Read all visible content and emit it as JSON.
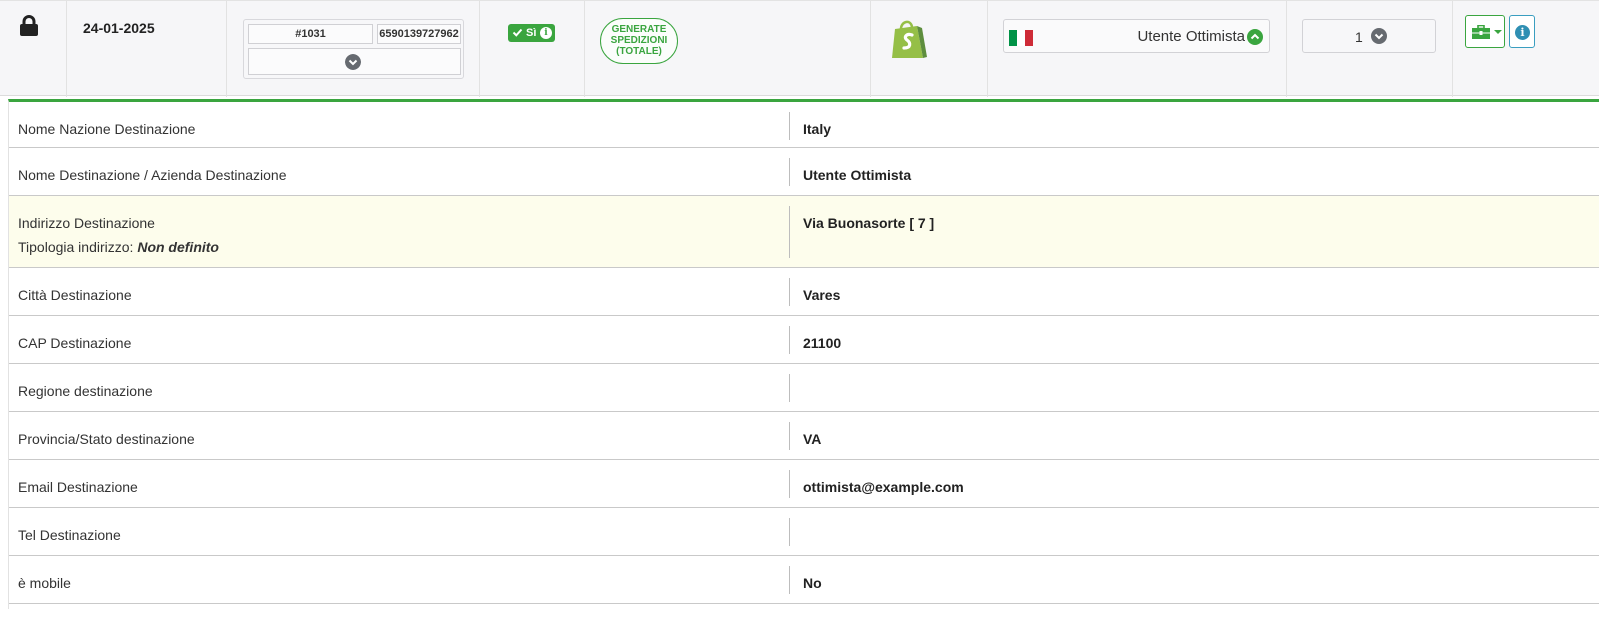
{
  "order": {
    "date": "24-01-2025",
    "order_number": "#1031",
    "external_id": "6590139727962",
    "status_badge": "Sì",
    "stamp_lines": [
      "GENERATE",
      "SPEDIZIONI",
      "(TOTALE)"
    ],
    "platform_icon": "shopify-icon",
    "customer_name": "Utente Ottimista",
    "country_flag_colors": [
      "#009246",
      "#ffffff",
      "#ce2b37"
    ],
    "quantity": "1"
  },
  "colors": {
    "accent_green": "#3aa53f",
    "info_blue": "#2f8fb3",
    "highlight_row": "#fdfdec"
  },
  "details": {
    "nazione": {
      "label": "Nome Nazione Destinazione",
      "value": "Italy"
    },
    "nome": {
      "label": "Nome Destinazione / Azienda Destinazione",
      "value": "Utente Ottimista"
    },
    "indirizzo": {
      "label": "Indirizzo Destinazione",
      "sub_label": "Tipologia indirizzo:",
      "sub_value": "Non definito",
      "value": "Via Buonasorte [ 7 ]"
    },
    "citta": {
      "label": "Città Destinazione",
      "value": "Vares"
    },
    "cap": {
      "label": "CAP Destinazione",
      "value": "21100"
    },
    "regione": {
      "label": "Regione destinazione",
      "value": ""
    },
    "provincia": {
      "label": "Provincia/Stato destinazione",
      "value": "VA"
    },
    "email": {
      "label": "Email Destinazione",
      "value": "ottimista@example.com"
    },
    "tel": {
      "label": "Tel Destinazione",
      "value": ""
    },
    "mobile": {
      "label": "è mobile",
      "value": "No"
    }
  }
}
